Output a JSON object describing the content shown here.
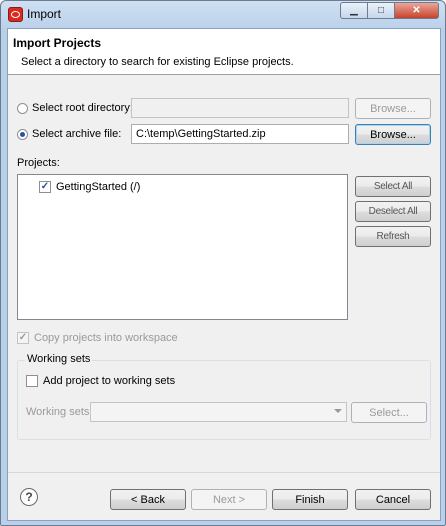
{
  "window": {
    "title": "Import"
  },
  "banner": {
    "title": "Import Projects",
    "description": "Select a directory to search for existing Eclipse projects."
  },
  "source": {
    "root_label": "Select root directory:",
    "root_value": "",
    "root_browse": "Browse...",
    "archive_label": "Select archive file:",
    "archive_value": "C:\\temp\\GettingStarted.zip",
    "archive_browse": "Browse...",
    "selected": "archive"
  },
  "projects": {
    "label": "Projects:",
    "items": [
      {
        "label": "GettingStarted (/)",
        "checked": true
      }
    ],
    "select_all": "Select All",
    "deselect_all": "Deselect All",
    "refresh": "Refresh"
  },
  "copy_option": {
    "label": "Copy projects into workspace",
    "checked": true,
    "enabled": false
  },
  "working_sets": {
    "title": "Working sets",
    "add_label": "Add project to working sets",
    "add_checked": false,
    "field_label": "Working sets:",
    "field_value": "",
    "select_button": "Select..."
  },
  "footer": {
    "help": "?",
    "back": "< Back",
    "next": "Next >",
    "finish": "Finish",
    "cancel": "Cancel"
  },
  "icons": {
    "app": "eclipse-app-icon",
    "minimize": "minimize-icon",
    "maximize": "maximize-icon",
    "close": "close-icon",
    "help": "help-icon",
    "dropdown": "chevron-down-icon"
  },
  "colors": {
    "accent": "#2a4fa0",
    "close": "#c8432a",
    "app_icon": "#d82a1e"
  }
}
